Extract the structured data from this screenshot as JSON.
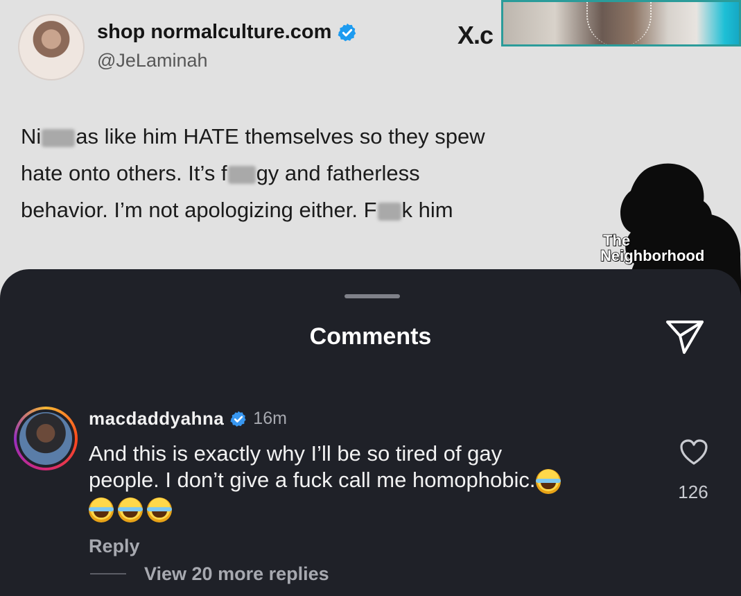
{
  "tweet": {
    "display_name": "shop normalculture.com",
    "handle": "@JeLaminah",
    "brand": "X.c",
    "lines": [
      [
        "Ni",
        "as like him HATE themselves so they spew"
      ],
      [
        "hate onto others. It’s f",
        "gy and fatherless"
      ],
      [
        "behavior. I’m not apologizing either. F",
        "k him"
      ]
    ]
  },
  "watermark": {
    "line1": "The",
    "line2": "Neighborhood"
  },
  "sheet": {
    "title": "Comments",
    "comment": {
      "username": "macdaddyahna",
      "time": "16m",
      "text_line1": "And this is exactly why I’ll be so tired of gay",
      "text_line2": "people. I don’t give a fuck call me homophobic.",
      "emoji_count": 4,
      "likes": "126",
      "reply_label": "Reply",
      "view_more_label": "View 20 more replies"
    }
  },
  "colors": {
    "sheet_bg": "#1f2128",
    "verified": "#3897f0",
    "tweet_bg": "#e1e1e1"
  },
  "icons": [
    "verified-badge-icon",
    "send-icon",
    "heart-icon",
    "laughing-emoji-icon"
  ]
}
